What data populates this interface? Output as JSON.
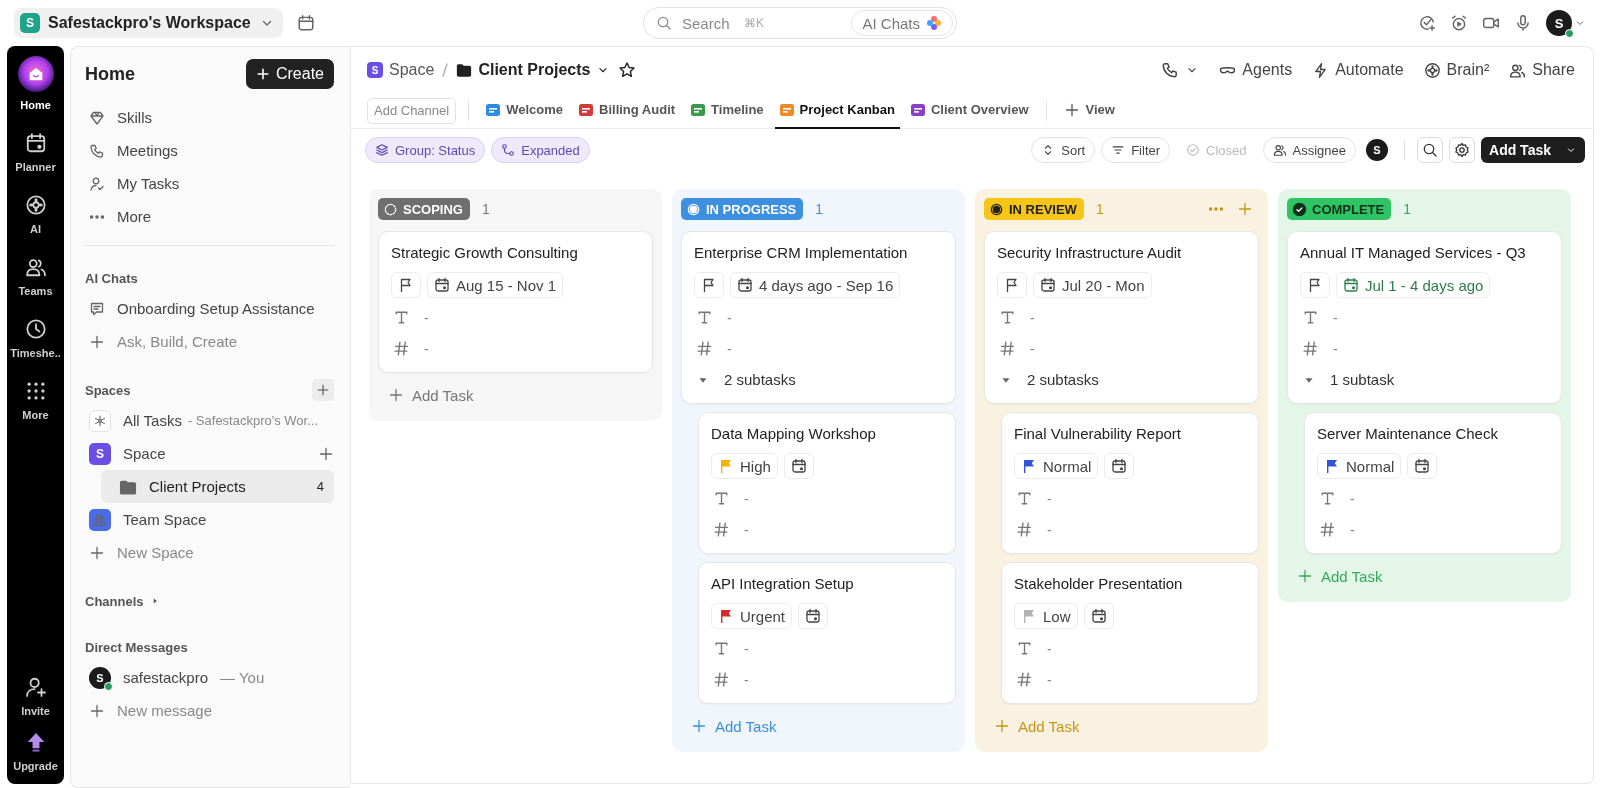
{
  "workspace": {
    "initial": "S",
    "name": "Safestackpro's Workspace"
  },
  "search": {
    "placeholder": "Search",
    "shortcut": "⌘K",
    "ai_button": "AI Chats"
  },
  "user": {
    "initial": "S"
  },
  "rail": [
    {
      "label": "Home",
      "selected": true
    },
    {
      "label": "Planner",
      "selected": false
    },
    {
      "label": "AI",
      "selected": false
    },
    {
      "label": "Teams",
      "selected": false
    },
    {
      "label": "Timeshe..",
      "selected": false
    },
    {
      "label": "More",
      "selected": false
    }
  ],
  "rail_bottom": [
    "Invite",
    "Upgrade"
  ],
  "sidebar": {
    "title": "Home",
    "create_button": "Create",
    "nav": [
      "Skills",
      "Meetings",
      "My Tasks",
      "More"
    ],
    "ai_chats": {
      "heading": "AI Chats",
      "items": [
        "Onboarding Setup Assistance"
      ],
      "new_item": "Ask, Build, Create"
    },
    "spaces": {
      "heading": "Spaces",
      "items": [
        {
          "kind": "all",
          "label": "All Tasks",
          "detail": "- Safestackpro's Wor...",
          "selected": false
        },
        {
          "kind": "space",
          "initial": "S",
          "label": "Space",
          "color": "#6a4ee6",
          "selected": false,
          "children": [
            {
              "kind": "folder",
              "label": "Client Projects",
              "count": "4",
              "selected": true
            }
          ]
        },
        {
          "kind": "team",
          "label": "Team Space",
          "color": "#4a6de5",
          "selected": false
        }
      ],
      "new_item": "New Space"
    },
    "channels": {
      "heading": "Channels"
    },
    "direct_messages": {
      "heading": "Direct Messages",
      "items": [
        {
          "initial": "S",
          "name": "safestackpro",
          "suffix": "— You"
        }
      ],
      "new_item": "New message"
    }
  },
  "breadcrumb": {
    "space": {
      "initial": "S",
      "label": "Space"
    },
    "page": "Client Projects"
  },
  "actions": [
    "Agents",
    "Automate",
    "Brain²",
    "Share"
  ],
  "add_channel": "Add Channel",
  "views": [
    {
      "label": "Welcome",
      "color": "#2b8be6",
      "selected": false
    },
    {
      "label": "Billing Audit",
      "color": "#d33a3a",
      "selected": false
    },
    {
      "label": "Timeline",
      "color": "#3a9a4a",
      "selected": false
    },
    {
      "label": "Project Kanban",
      "color": "#f08a24",
      "selected": true
    },
    {
      "label": "Client Overview",
      "color": "#8b3fc7",
      "selected": false
    }
  ],
  "add_view": "View",
  "chips": [
    "Group: Status",
    "Expanded"
  ],
  "controls": [
    {
      "label": "Sort",
      "disabled": false
    },
    {
      "label": "Filter",
      "disabled": false
    },
    {
      "label": "Closed",
      "disabled": true
    },
    {
      "label": "Assignee",
      "disabled": false
    }
  ],
  "assignee_initial": "S",
  "add_task": "Add Task",
  "columns": [
    {
      "kind": "scoping",
      "status": "SCOPING",
      "count": "1",
      "color": "#6f6f6f",
      "hovered": false,
      "add_label": "Add Task",
      "cards": [
        {
          "title": "Strategic Growth Consulting",
          "date": "Aug 15 - Nov 1",
          "fields": [
            "-",
            "-"
          ]
        }
      ]
    },
    {
      "kind": "in_progress",
      "status": "IN PROGRESS",
      "count": "1",
      "color": "#3d8fe0",
      "hovered": false,
      "add_label": "Add Task",
      "cards": [
        {
          "title": "Enterprise CRM Implementation",
          "date": "4 days ago - Sep 16",
          "fields": [
            "-",
            "-"
          ],
          "subtasks": "2 subtasks",
          "expanded": true,
          "children": [
            {
              "title": "Data Mapping Workshop",
              "priority": {
                "label": "High",
                "color": "#f5b400"
              },
              "fields": [
                "-",
                "-"
              ]
            },
            {
              "title": "API Integration Setup",
              "priority": {
                "label": "Urgent",
                "color": "#d42a2a"
              },
              "fields": [
                "-",
                "-"
              ]
            }
          ]
        }
      ]
    },
    {
      "kind": "in_review",
      "status": "IN REVIEW",
      "count": "1",
      "color": "#f5c518",
      "hovered": true,
      "add_label": "Add Task",
      "cards": [
        {
          "title": "Security Infrastructure Audit",
          "date": "Jul 20 - Mon",
          "fields": [
            "-",
            "-"
          ],
          "subtasks": "2 subtasks",
          "expanded": true,
          "children": [
            {
              "title": "Final Vulnerability Report",
              "priority": {
                "label": "Normal",
                "color": "#3453d6"
              },
              "fields": [
                "-",
                "-"
              ]
            },
            {
              "title": "Stakeholder Presentation",
              "priority": {
                "label": "Low",
                "color": "#b3b3b3"
              },
              "fields": [
                "-",
                "-"
              ]
            }
          ]
        }
      ]
    },
    {
      "kind": "complete",
      "status": "COMPLETE",
      "count": "1",
      "color": "#2fc463",
      "hovered": false,
      "add_label": "Add Task",
      "cards": [
        {
          "title": "Annual IT Managed Services - Q3",
          "date": "Jul 1 - 4 days ago",
          "fields": [
            "-",
            "-"
          ],
          "subtasks": "1 subtask",
          "expanded": true,
          "children": [
            {
              "title": "Server Maintenance Check",
              "priority": {
                "label": "Normal",
                "color": "#3453d6"
              },
              "fields": [
                "-",
                "-"
              ]
            }
          ]
        }
      ]
    }
  ]
}
